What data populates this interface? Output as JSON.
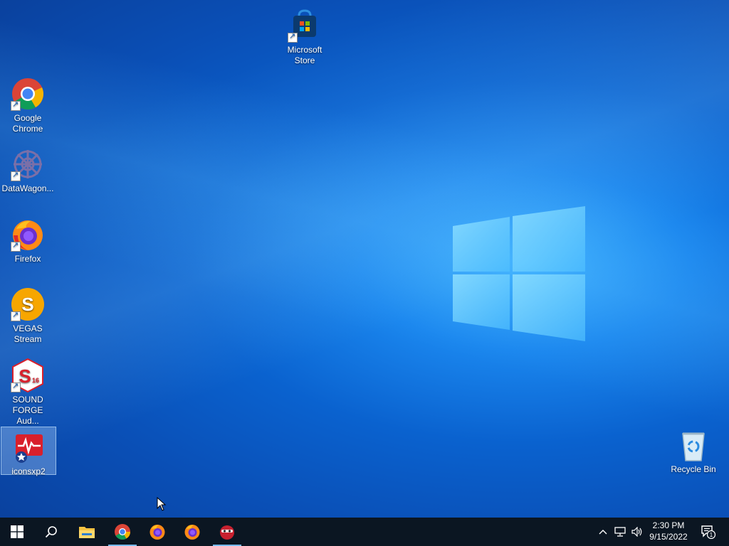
{
  "desktop": {
    "icons": [
      {
        "label": "Microsoft Store"
      },
      {
        "label": "Google Chrome"
      },
      {
        "label": "DataWagon..."
      },
      {
        "label": "Firefox"
      },
      {
        "label": "VEGAS Stream"
      },
      {
        "label": "SOUND FORGE Aud..."
      },
      {
        "label": "iconsxp2"
      },
      {
        "label": "Recycle Bin"
      }
    ]
  },
  "taskbar": {
    "pinned": [
      "start-icon",
      "search-icon",
      "file-explorer-icon",
      "chrome-icon",
      "firefox-icon",
      "firefox-icon",
      "app-icon"
    ],
    "tray": {
      "time": "2:30 PM",
      "date": "9/15/2022",
      "notification_count": "1"
    }
  },
  "colors": {
    "taskbar_bg": "#0b1622",
    "accent": "#76b9ed"
  }
}
